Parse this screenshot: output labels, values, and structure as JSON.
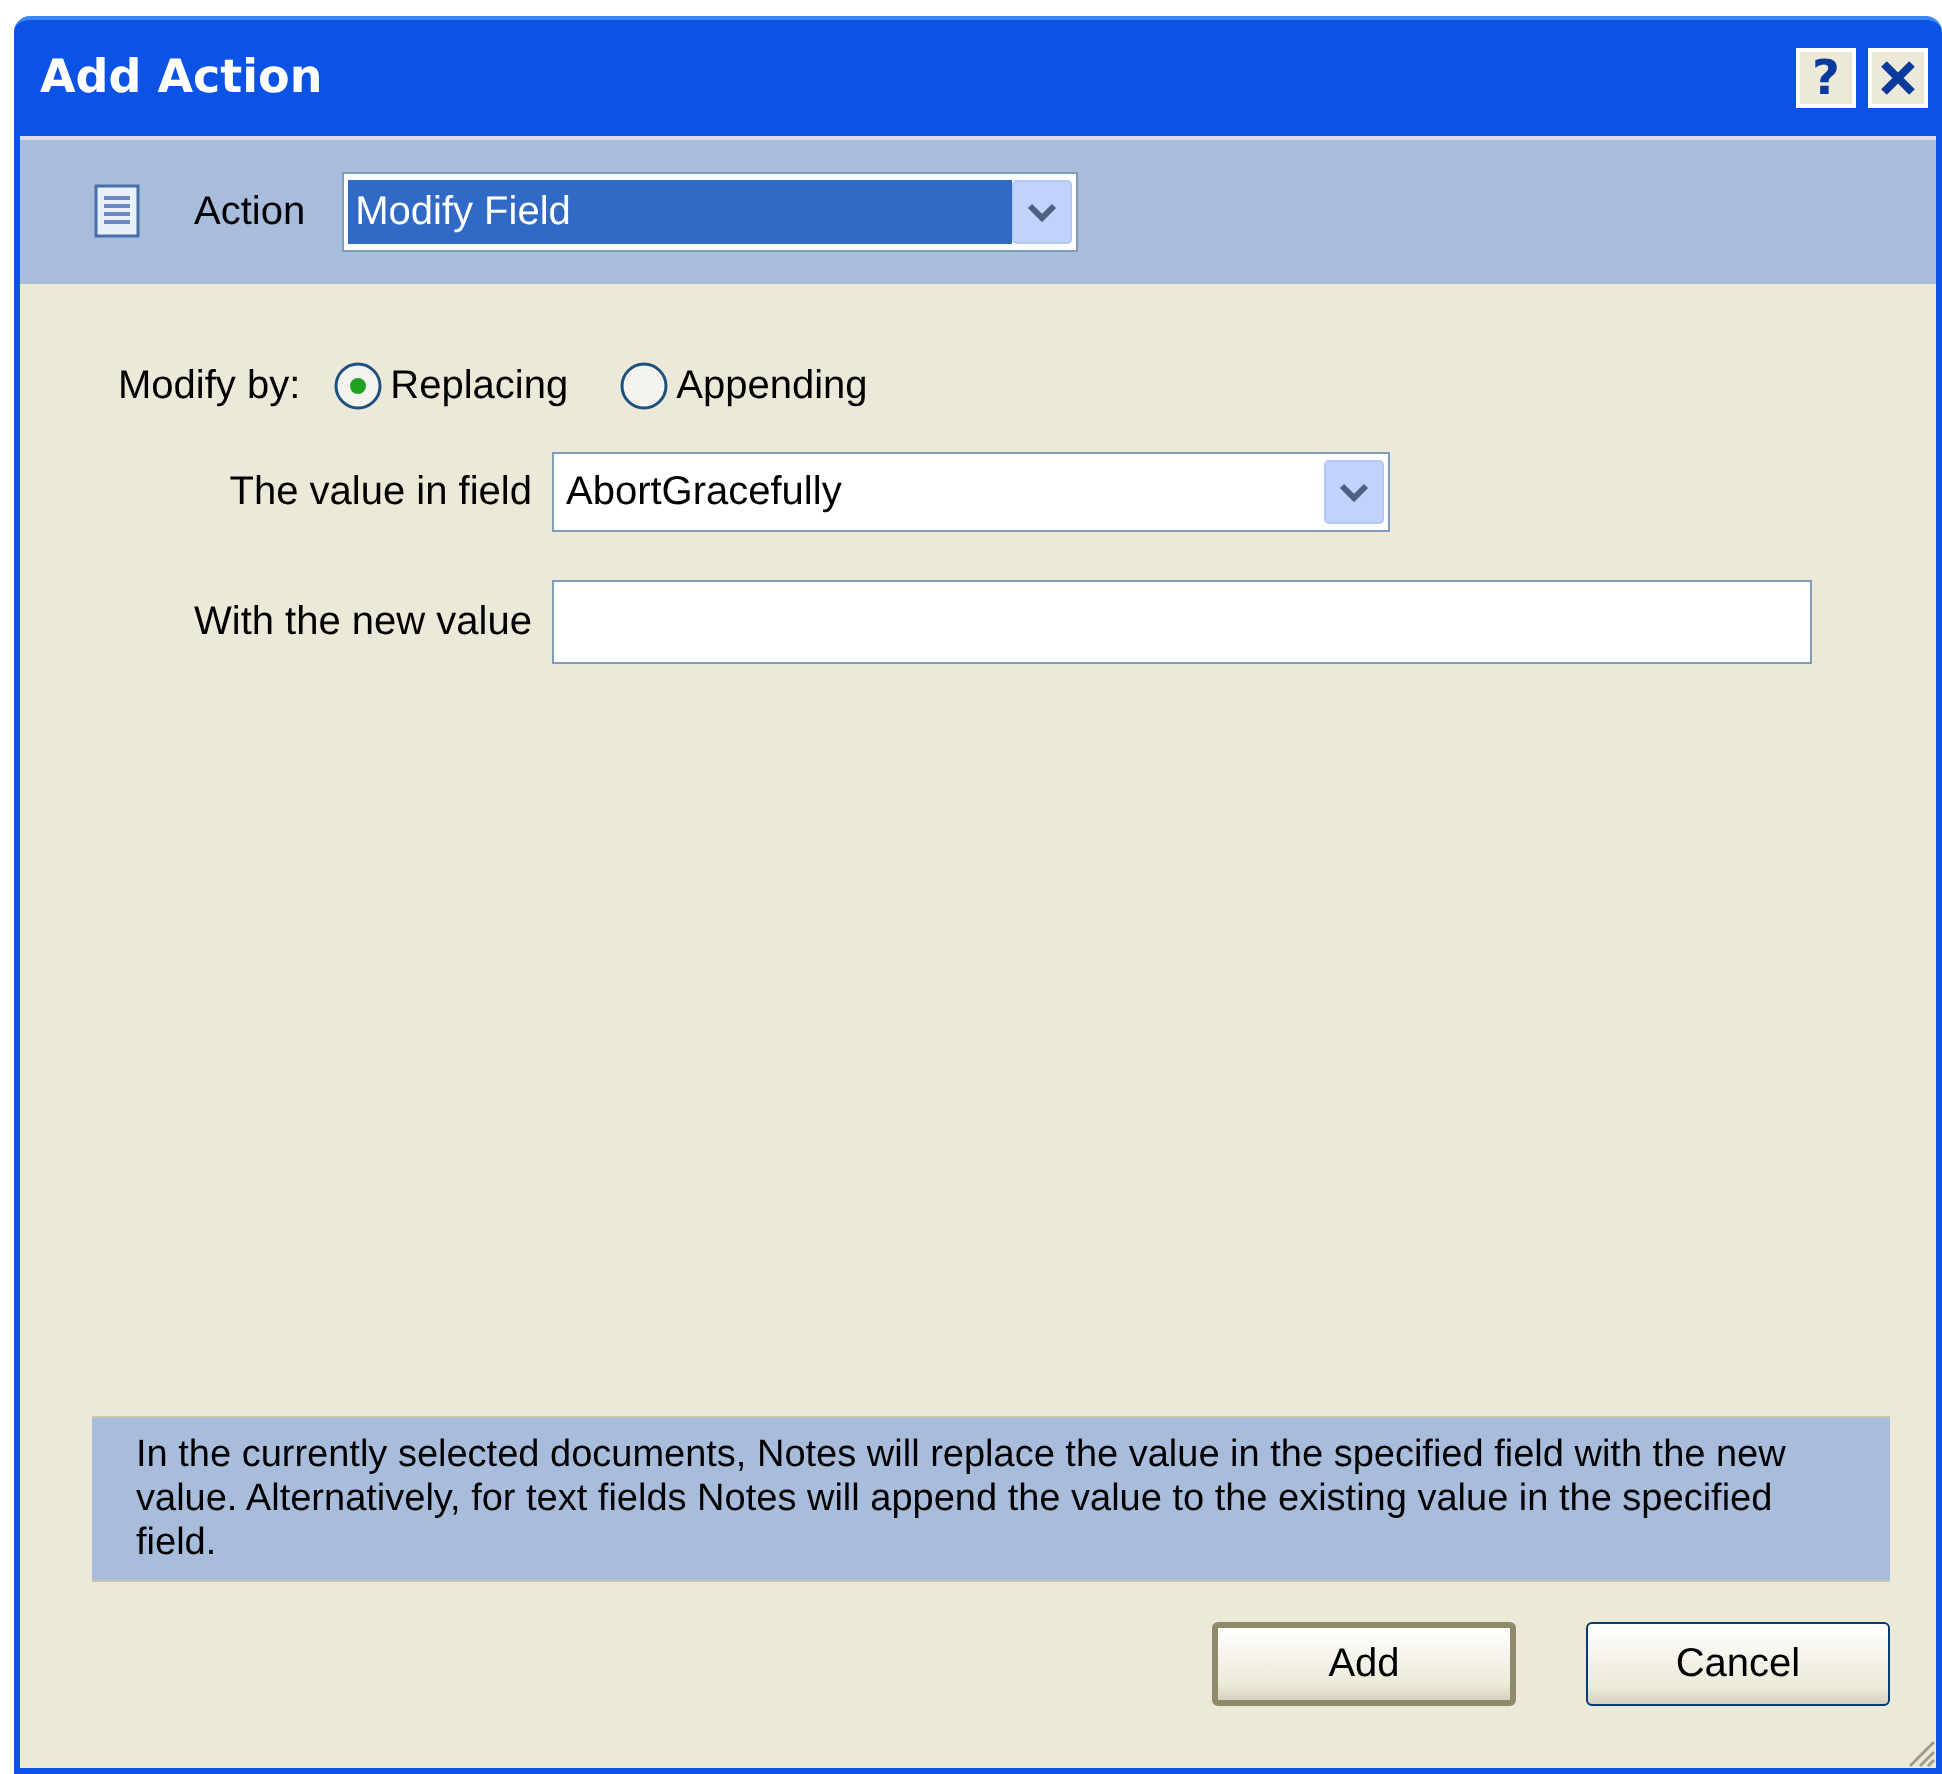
{
  "window": {
    "title": "Add Action",
    "help_button": "?"
  },
  "action": {
    "label": "Action",
    "value": "Modify Field"
  },
  "modify_by": {
    "label": "Modify by:",
    "options": [
      {
        "label": "Replacing",
        "selected": true
      },
      {
        "label": "Appending",
        "selected": false
      }
    ]
  },
  "fields": [
    {
      "kind": "dropdown",
      "label": "The value in field",
      "value": "AbortGracefully"
    },
    {
      "kind": "text",
      "label": "With the new value"
    }
  ],
  "description": "In the currently selected documents, Notes will replace the value in the specified field with the new value.  Alternatively, for text fields Notes will append the value to the existing value in the specified field.",
  "buttons": [
    {
      "label": "Add",
      "default": true
    },
    {
      "label": "Cancel",
      "default": false
    }
  ]
}
